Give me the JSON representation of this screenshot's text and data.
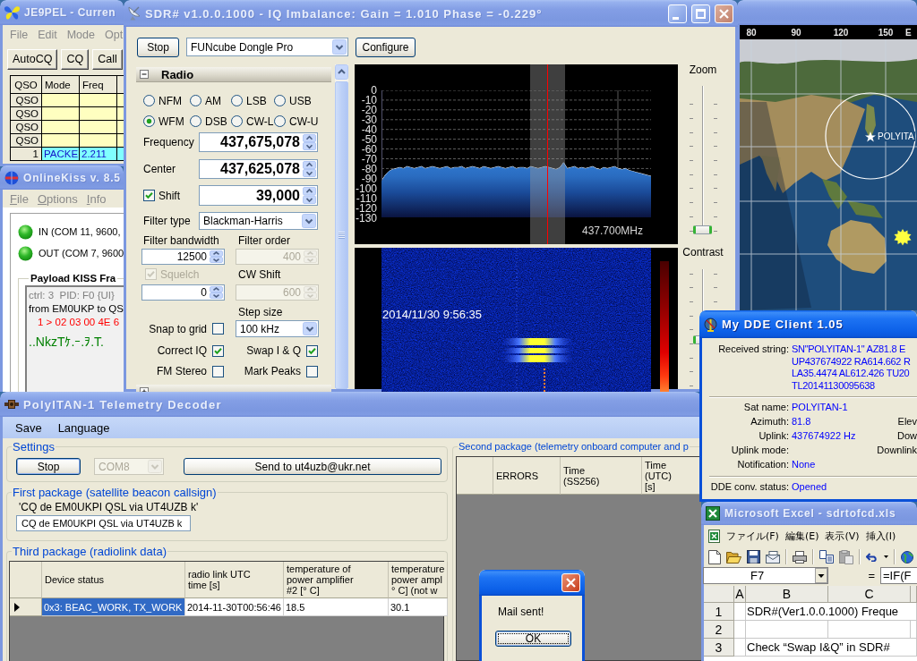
{
  "logger": {
    "title": "JE9PEL - Curren",
    "active": false,
    "menu": [
      "File",
      "Edit",
      "Mode",
      "Opt"
    ],
    "buttons": [
      "AutoCQ",
      "CQ",
      "Call"
    ],
    "grid": {
      "columns": [
        "QSO",
        "Mode",
        "Freq"
      ],
      "rows": [
        {
          "label": "QSO",
          "selected": false
        },
        {
          "label": "QSO",
          "selected": false
        },
        {
          "label": "QSO",
          "selected": false
        },
        {
          "label": "QSO",
          "selected": false
        },
        {
          "label": "1",
          "cells": [
            "PACKE",
            "2.211"
          ],
          "selected": true
        }
      ]
    }
  },
  "kiss": {
    "title": "OnlineKiss v. 8.5",
    "active": false,
    "menu": [
      "File",
      "Options",
      "Info"
    ],
    "ports": [
      {
        "label": "IN (COM 11, 9600,",
        "on": true
      },
      {
        "label": "OUT (COM 7, 9600",
        "on": true
      }
    ],
    "payload": {
      "title": "Payload KISS Fra",
      "lines": [
        {
          "kind": "header",
          "text": "ctrl: 3  PID: F0 {UI}"
        },
        {
          "kind": "address",
          "text": "from EM0UKP to QS"
        },
        {
          "kind": "hex",
          "text": "1 > 02 03 00 4E 6"
        },
        {
          "kind": "ascii",
          "text": "..NkzTｹ.ｰ.ｦ.T."
        }
      ]
    }
  },
  "map": {
    "active": false,
    "longitudes": [
      "80",
      "90",
      "120",
      "150",
      "E"
    ],
    "satellite_label": "POLYITA"
  },
  "sdr": {
    "title": "SDR# v1.0.0.1000 - IQ Imbalance: Gain = 1.010 Phase = -0.229°",
    "active": false,
    "start_button": "Stop",
    "device": "FUNcube Dongle Pro",
    "configure_button": "Configure",
    "radio_panel": {
      "title": "Radio",
      "expanded": true,
      "modes": [
        {
          "label": "NFM",
          "selected": false
        },
        {
          "label": "AM",
          "selected": false
        },
        {
          "label": "LSB",
          "selected": false
        },
        {
          "label": "USB",
          "selected": false
        },
        {
          "label": "WFM",
          "selected": true
        },
        {
          "label": "DSB",
          "selected": false
        },
        {
          "label": "CW-L",
          "selected": false
        },
        {
          "label": "CW-U",
          "selected": false
        }
      ],
      "frequency": {
        "label": "Frequency",
        "value": "437,675,078"
      },
      "center": {
        "label": "Center",
        "value": "437,625,078"
      },
      "shift": {
        "label": "Shift",
        "checked": true,
        "value": "39,000"
      },
      "filter_type": {
        "label": "Filter type",
        "value": "Blackman-Harris"
      },
      "filter_bandwidth": {
        "label": "Filter bandwidth",
        "value": "12500",
        "disabled": false
      },
      "filter_order": {
        "label": "Filter order",
        "value": "400",
        "disabled": true
      },
      "squelch": {
        "label": "Squelch",
        "checked": true,
        "disabled": true
      },
      "squelch_level": {
        "value": "0",
        "disabled": false
      },
      "cw_shift": {
        "label": "CW Shift",
        "value": "600",
        "disabled": true
      },
      "step_size": {
        "label": "Step size",
        "value": "100 kHz"
      },
      "options": [
        {
          "label": "Snap to grid",
          "checked": false
        },
        {
          "label": "Correct IQ",
          "checked": true
        },
        {
          "label": "Swap I & Q",
          "checked": true
        },
        {
          "label": "FM Stereo",
          "checked": false
        },
        {
          "label": "Mark Peaks",
          "checked": false
        }
      ]
    },
    "audio_panel": {
      "expanded": false
    },
    "spectrum": {
      "chart_data": {
        "type": "line",
        "grid": true,
        "ylim": [
          -130,
          0
        ],
        "yticks": [
          0,
          -10,
          -20,
          -30,
          -40,
          -50,
          -60,
          -70,
          -80,
          -90,
          -100,
          -110,
          -120,
          -130
        ],
        "values": [
          -93,
          -87,
          -83,
          -81,
          -80,
          -79,
          -80,
          -78,
          -79,
          -80,
          -79,
          -78,
          -80,
          -79,
          -78,
          -79,
          -80,
          -79,
          -78,
          -80,
          -79,
          -79,
          -78,
          -80,
          -79,
          -78,
          -79,
          -80,
          -78,
          -79,
          -80,
          -79,
          -78,
          -79,
          -80,
          -79,
          -78,
          -80,
          -79,
          -79,
          -80,
          -78,
          -79,
          -80,
          -79,
          -78,
          -79,
          -80,
          -81,
          -79,
          -74,
          -80,
          -79,
          -78,
          -80,
          -79,
          -80,
          -79,
          -78,
          -80,
          -81,
          -79,
          -80,
          -79,
          -78,
          -80,
          -81,
          -80,
          -82,
          -83,
          -84,
          -85,
          -86,
          -87,
          -88
        ]
      },
      "frequency_label": "437.700MHz"
    },
    "waterfall": {
      "timestamp": "2014/11/30 9:56:35"
    },
    "zoom": {
      "label": "Zoom",
      "level": 0
    },
    "contrast": {
      "label": "Contrast",
      "level": 0.4
    }
  },
  "telemetry": {
    "title": "PolyITAN-1 Telemetry Decoder",
    "active": false,
    "menu": [
      "Save",
      "Language"
    ],
    "settings": {
      "title": "Settings",
      "stop_button": "Stop",
      "port": {
        "value": "COM8",
        "disabled": true
      },
      "send_button": "Send to ut4uzb@ukr.net"
    },
    "first_package": {
      "title": "First package (satellite beacon callsign)",
      "decoded": "'CQ de EM0UKPI QSL via UT4UZB k'",
      "value": "CQ de EM0UKPI QSL via UT4UZB k"
    },
    "third_package": {
      "title": "Third package (radiolink data)",
      "columns": [
        "Device status",
        "radio link UTC\ntime [s]",
        "temperature of\npower amplifier\n#2 [° C]",
        "temperature\npower ampl\n° C] (not w"
      ],
      "rows": [
        {
          "current": true,
          "cells": [
            {
              "text": "0x3: BEAC_WORK, TX_WORK",
              "selected": true
            },
            {
              "text": "2014-11-30T00:56:46",
              "selected": false
            },
            {
              "text": "18.5",
              "selected": false
            },
            {
              "text": "30.1",
              "selected": false
            }
          ]
        }
      ]
    },
    "second_package": {
      "title": "Second package (telemetry onboard computer and p",
      "columns": [
        "ERRORS",
        "Time\n(SS256)",
        "Time\n(UTC)\n[s]"
      ]
    }
  },
  "dde": {
    "title": "My DDE Client 1.05",
    "active": true,
    "received": {
      "label": "Received string:",
      "lines": [
        "SN\"POLYITAN-1\" AZ81.8 E",
        "UP437674922 RA614.662 R",
        "LA35.4474 AL612.426 TU20",
        "TL20141130095638"
      ]
    },
    "fields": [
      {
        "label": "Sat name:",
        "value": "POLYITAN-1"
      },
      {
        "label": "Azimuth:",
        "value": "81.8",
        "right_label": "Elev"
      },
      {
        "label": "Uplink:",
        "value": "437674922 Hz",
        "right_label": "Dow"
      },
      {
        "label": "Uplink mode:",
        "right_label": "Downlink"
      },
      {
        "label": "Notification:",
        "value": "None"
      }
    ],
    "status": {
      "label": "DDE conv. status:",
      "value": "Opened"
    }
  },
  "excel": {
    "title": "Microsoft Excel - sdrtofcd.xls",
    "active": false,
    "menu": [
      "ファイル(F)",
      "編集(E)",
      "表示(V)",
      "挿入(I)"
    ],
    "toolbar": [
      {
        "kind": "new",
        "disabled": false
      },
      {
        "kind": "open",
        "disabled": false
      },
      {
        "kind": "save",
        "disabled": false
      },
      {
        "kind": "mail",
        "disabled": false
      },
      {
        "kind": "print",
        "disabled": false
      },
      {
        "kind": "copy",
        "disabled": false
      },
      {
        "kind": "paste",
        "disabled": true
      },
      {
        "kind": "undo",
        "disabled": false
      },
      {
        "kind": "undo_list",
        "disabled": false
      },
      {
        "kind": "web",
        "disabled": false
      }
    ],
    "name_box": "F7",
    "equals": "=",
    "formula": "=IF(F",
    "columns": [
      "A",
      "B",
      "C"
    ],
    "rows": [
      {
        "label": "1",
        "cell_b": "SDR#(Ver1.0.0.1000) Freque"
      },
      {
        "label": "2"
      },
      {
        "label": "3",
        "cell_b": "Check “Swap I&Q” in SDR#"
      }
    ]
  },
  "mail_dialog": {
    "active": true,
    "message": "Mail sent!",
    "button": "OK"
  }
}
